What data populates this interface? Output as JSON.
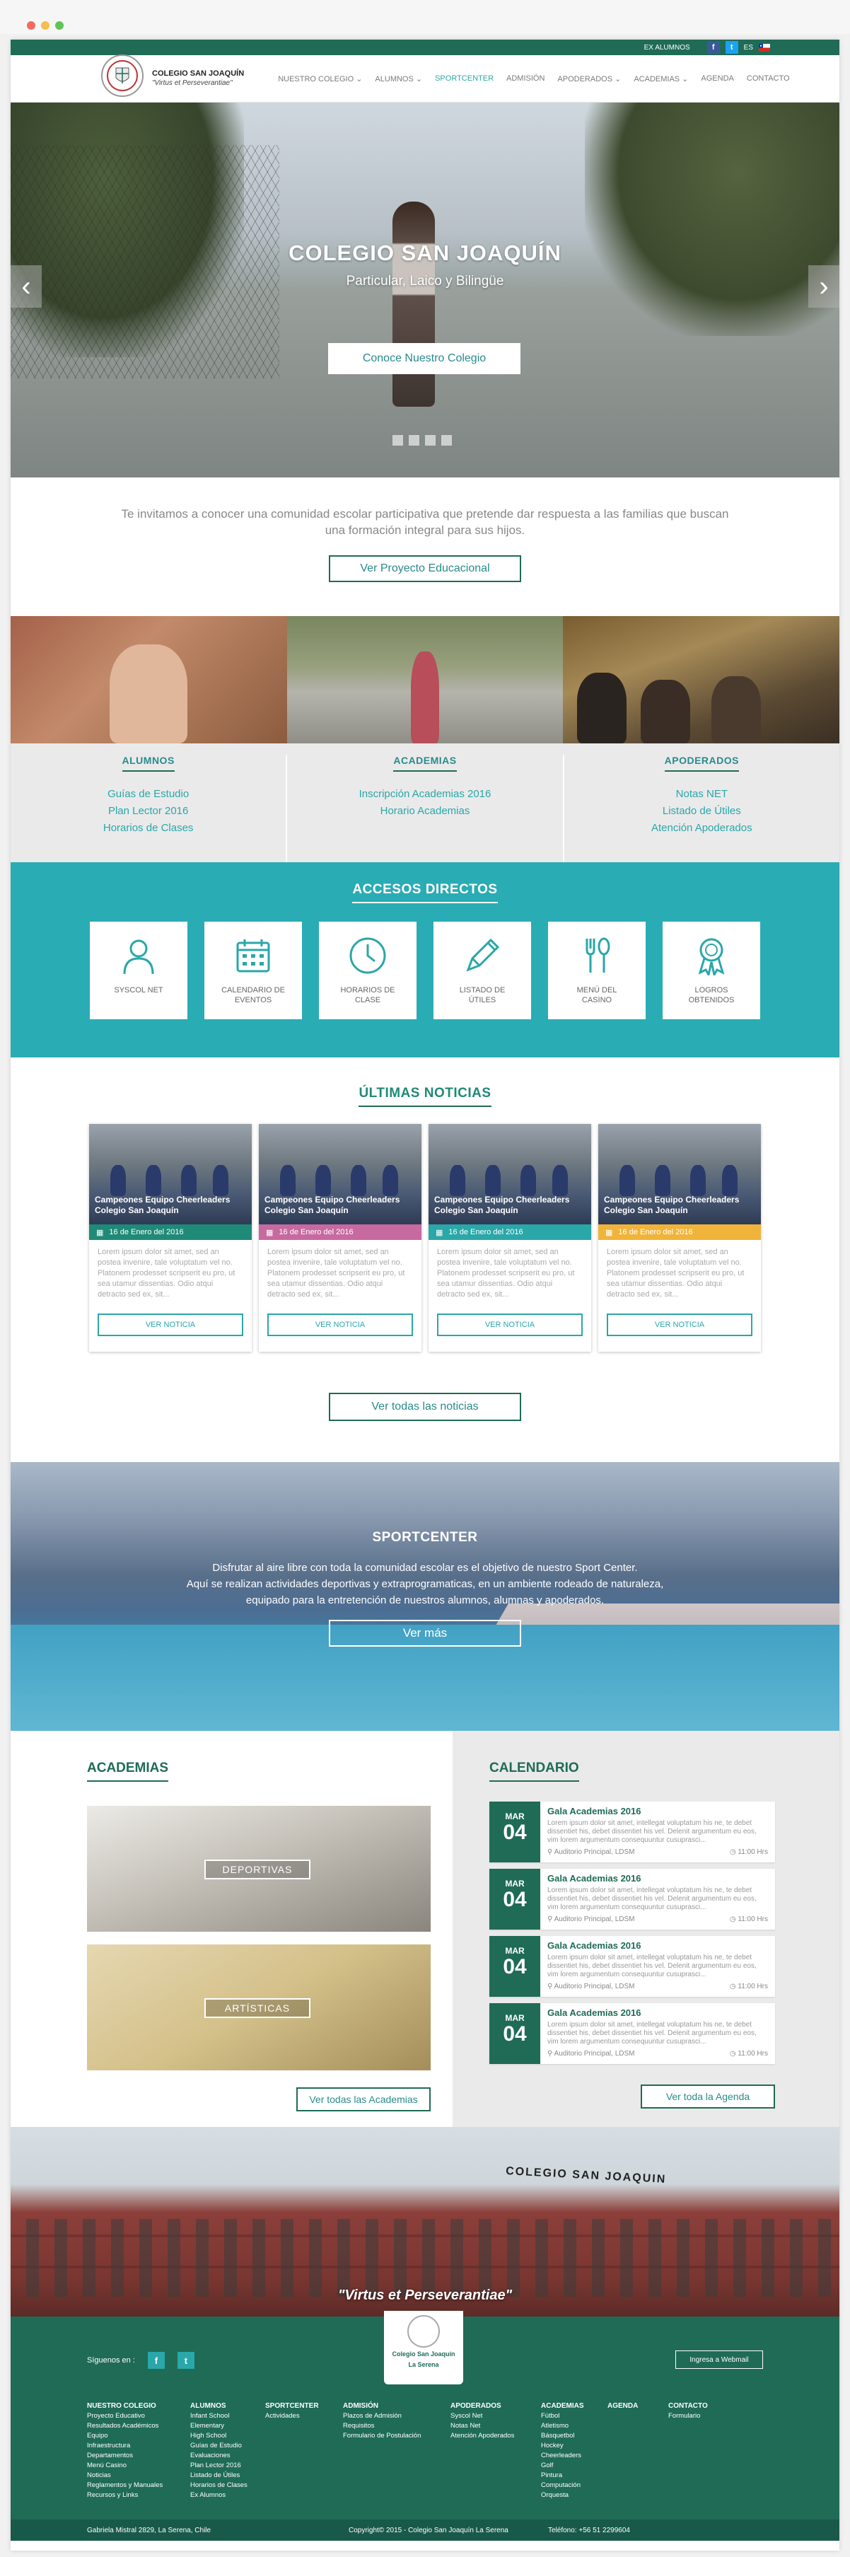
{
  "colors": {
    "primary": "#1f6b56",
    "accent": "#2aa7a9",
    "teal_band": "#2aacb4",
    "date_green": "#1f8a77",
    "date_pink": "#c76aa0",
    "date_teal": "#2aa7a9",
    "date_yellow": "#f0b43a"
  },
  "topbar": {
    "exalumnos": "EX ALUMNOS",
    "facebook_icon": "f",
    "twitter_icon": "t",
    "lang": "ES"
  },
  "brand": {
    "name": "COLEGIO SAN JOAQUÍN",
    "motto": "\"Virtus et Perseverantiae\""
  },
  "nav": [
    {
      "label": "NUESTRO COLEGIO ⌄"
    },
    {
      "label": "ALUMNOS ⌄"
    },
    {
      "label": "SPORTCENTER"
    },
    {
      "label": "ADMISIÓN"
    },
    {
      "label": "APODERADOS ⌄"
    },
    {
      "label": "ACADEMIAS ⌄"
    },
    {
      "label": "AGENDA"
    },
    {
      "label": "CONTACTO"
    }
  ],
  "hero": {
    "title": "COLEGIO SAN JOAQUÍN",
    "subtitle": "Particular, Laico y Bilingüe",
    "cta": "Conoce Nuestro Colegio",
    "prev": "‹",
    "next": "›"
  },
  "intro": {
    "text": "Te invitamos a conocer una comunidad escolar participativa que pretende dar respuesta a las familias que buscan una formación integral para sus hijos.",
    "button": "Ver Proyecto Educacional"
  },
  "columns": [
    {
      "title": "ALUMNOS",
      "links": [
        "Guías de Estudio",
        "Plan Lector 2016",
        "Horarios de Clases"
      ]
    },
    {
      "title": "ACADEMIAS",
      "links": [
        "Inscripción Academias 2016",
        "Horario Academias"
      ]
    },
    {
      "title": "APODERADOS",
      "links": [
        "Notas NET",
        "Listado de Útiles",
        "Atención Apoderados"
      ]
    }
  ],
  "accesos": {
    "title": "ACCESOS DIRECTOS",
    "tiles": [
      {
        "label": "SYSCOL NET",
        "icon": "user-icon"
      },
      {
        "label": "CALENDARIO DE EVENTOS",
        "icon": "calendar-icon"
      },
      {
        "label": "HORARIOS DE CLASE",
        "icon": "clock-icon"
      },
      {
        "label": "LISTADO DE ÚTILES",
        "icon": "pencil-icon"
      },
      {
        "label": "MENÚ DEL CASINO",
        "icon": "cutlery-icon"
      },
      {
        "label": "LOGROS OBTENIDOS",
        "icon": "medal-icon"
      }
    ]
  },
  "noticias": {
    "title": "ÚLTIMAS NOTICIAS",
    "cards": [
      {
        "caption": "Campeones Equipo Cheerleaders Colegio San Joaquín",
        "date": "16 de Enero del 2016",
        "color": "#1f8a77",
        "body": "Lorem ipsum dolor sit amet, sed an postea invenire, tale voluptatum vel no. Platonem prodesset scripserit eu pro, ut sea utamur dissentias. Odio atqui detracto sed ex, sit...",
        "button": "VER NOTICIA"
      },
      {
        "caption": "Campeones Equipo Cheerleaders Colegio San Joaquín",
        "date": "16 de Enero del 2016",
        "color": "#c76aa0",
        "body": "Lorem ipsum dolor sit amet, sed an postea invenire, tale voluptatum vel no. Platonem prodesset scripserit eu pro, ut sea utamur dissentias. Odio atqui detracto sed ex, sit...",
        "button": "VER NOTICIA"
      },
      {
        "caption": "Campeones Equipo Cheerleaders Colegio San Joaquín",
        "date": "16 de Enero del 2016",
        "color": "#2aa7a9",
        "body": "Lorem ipsum dolor sit amet, sed an postea invenire, tale voluptatum vel no. Platonem prodesset scripserit eu pro, ut sea utamur dissentias. Odio atqui detracto sed ex, sit...",
        "button": "VER NOTICIA"
      },
      {
        "caption": "Campeones Equipo Cheerleaders Colegio San Joaquín",
        "date": "16 de Enero del 2016",
        "color": "#f0b43a",
        "body": "Lorem ipsum dolor sit amet, sed an postea invenire, tale voluptatum vel no. Platonem prodesset scripserit eu pro, ut sea utamur dissentias. Odio atqui detracto sed ex, sit...",
        "button": "VER NOTICIA"
      }
    ],
    "all_button": "Ver todas las noticias"
  },
  "sport": {
    "title": "SPORTCENTER",
    "lines": [
      "Disfrutar al aire libre con toda la comunidad escolar es el objetivo de nuestro Sport Center.",
      "Aquí se realizan actividades deportivas y extraprogramaticas, en un ambiente rodeado de naturaleza,",
      "equipado para la entretención de nuestros alumnos, alumnas y apoderados."
    ],
    "button": "Ver más"
  },
  "academias": {
    "title": "ACADEMIAS",
    "items": [
      "DEPORTIVAS",
      "ARTÍSTICAS"
    ],
    "button": "Ver todas las Academias"
  },
  "calendario": {
    "title": "CALENDARIO",
    "events": [
      {
        "month": "MAR",
        "day": "04",
        "title": "Gala Academias 2016",
        "text": "Lorem ipsum dolor sit amet, intellegat voluptatum his ne, te debet dissentiet his, debet dissentiet his vel. Delenit argumentum eu eos, vim lorem argumentum consequuntur cusuprasci...",
        "place": "Auditorio Principal, LDSM",
        "time": "11:00 Hrs"
      },
      {
        "month": "MAR",
        "day": "04",
        "title": "Gala Academias 2016",
        "text": "Lorem ipsum dolor sit amet, intellegat voluptatum his ne, te debet dissentiet his, debet dissentiet his vel. Delenit argumentum eu eos, vim lorem argumentum consequuntur cusuprasci...",
        "place": "Auditorio Principal, LDSM",
        "time": "11:00 Hrs"
      },
      {
        "month": "MAR",
        "day": "04",
        "title": "Gala Academias 2016",
        "text": "Lorem ipsum dolor sit amet, intellegat voluptatum his ne, te debet dissentiet his, debet dissentiet his vel. Delenit argumentum eu eos, vim lorem argumentum consequuntur cusuprasci...",
        "place": "Auditorio Principal, LDSM",
        "time": "11:00 Hrs"
      },
      {
        "month": "MAR",
        "day": "04",
        "title": "Gala Academias 2016",
        "text": "Lorem ipsum dolor sit amet, intellegat voluptatum his ne, te debet dissentiet his, debet dissentiet his vel. Delenit argumentum eu eos, vim lorem argumentum consequuntur cusuprasci...",
        "place": "Auditorio Principal, LDSM",
        "time": "11:00 Hrs"
      }
    ],
    "button": "Ver toda la Agenda"
  },
  "school": {
    "sign": "COLEGIO SAN JOAQUIN",
    "motto": "\"Virtus et Perseverantiae\""
  },
  "footer": {
    "follow": "Síguenos en :",
    "badge_name": "Colegio San Joaquín",
    "badge_city": "La Serena",
    "webmail": "Ingresa a Webmail",
    "columns": [
      {
        "title": "NUESTRO COLEGIO",
        "items": [
          "Proyecto Educativo",
          "Resultados Académicos",
          "Equipo",
          "Infraestructura",
          "Departamentos",
          "Menú Casino",
          "Noticias",
          "Reglamentos y Manuales",
          "Recursos y Links"
        ]
      },
      {
        "title": "ALUMNOS",
        "items": [
          "Infant School",
          "Elementary",
          "High School",
          "Guías de Estudio",
          "Evaluaciones",
          "Plan Lector 2016",
          "Listado de Útiles",
          "Horarios de Clases",
          "Ex Alumnos"
        ]
      },
      {
        "title": "SPORTCENTER",
        "items": [
          "Actividades"
        ]
      },
      {
        "title": "ADMISIÓN",
        "items": [
          "Plazos de Admisión",
          "Requisitos",
          "Formulario de Postulación"
        ]
      },
      {
        "title": "APODERADOS",
        "items": [
          "Syscol Net",
          "Notas Net",
          "Atención Apoderados"
        ]
      },
      {
        "title": "ACADEMIAS",
        "items": [
          "Fútbol",
          "Atletismo",
          "Básquetbol",
          "Hockey",
          "Cheerleaders",
          "Golf",
          "Pintura",
          "Computación",
          "Orquesta"
        ]
      },
      {
        "title": "AGENDA",
        "items": []
      },
      {
        "title": "CONTACTO",
        "items": [
          "Formulario"
        ]
      }
    ],
    "address": "Gabriela Mistral 2829, La Serena, Chile",
    "copyright": "Copyright© 2015 - Colegio San Joaquín La Serena",
    "phone": "Teléfono: +56 51 2299604"
  }
}
